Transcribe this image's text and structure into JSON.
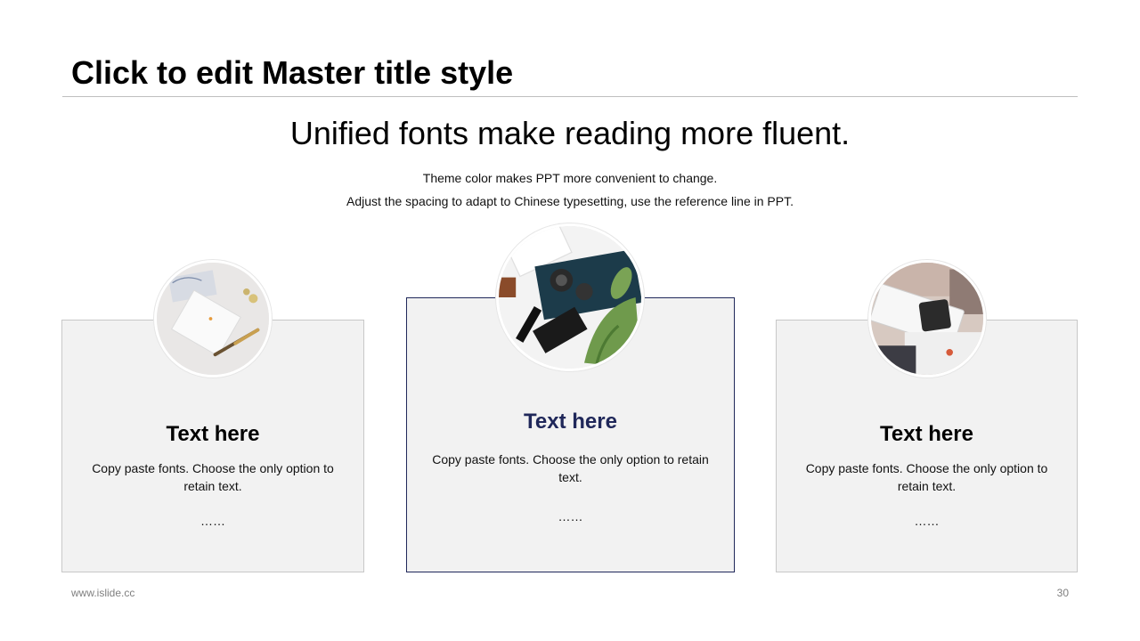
{
  "slide": {
    "title": "Click to edit Master title style",
    "headline": "Unified fonts make reading more fluent.",
    "sublines": [
      "Theme color makes PPT more convenient to change.",
      "Adjust the spacing to adapt to Chinese typesetting, use the reference line in PPT."
    ]
  },
  "cards": [
    {
      "heading": "Text here",
      "body": "Copy paste fonts. Choose the only option to retain text.",
      "more": "……"
    },
    {
      "heading": "Text here",
      "body": "Copy paste fonts. Choose the only option to retain text.",
      "more": "……"
    },
    {
      "heading": "Text here",
      "body": "Copy paste fonts. Choose the only option to retain text.",
      "more": "……"
    }
  ],
  "footer": {
    "site": "www.islide.cc",
    "page_number": "30"
  },
  "colors": {
    "accent": "#20285a",
    "card_fill": "#f2f2f2",
    "card_border": "#c8c8c8",
    "rule": "#bfbfbf"
  }
}
